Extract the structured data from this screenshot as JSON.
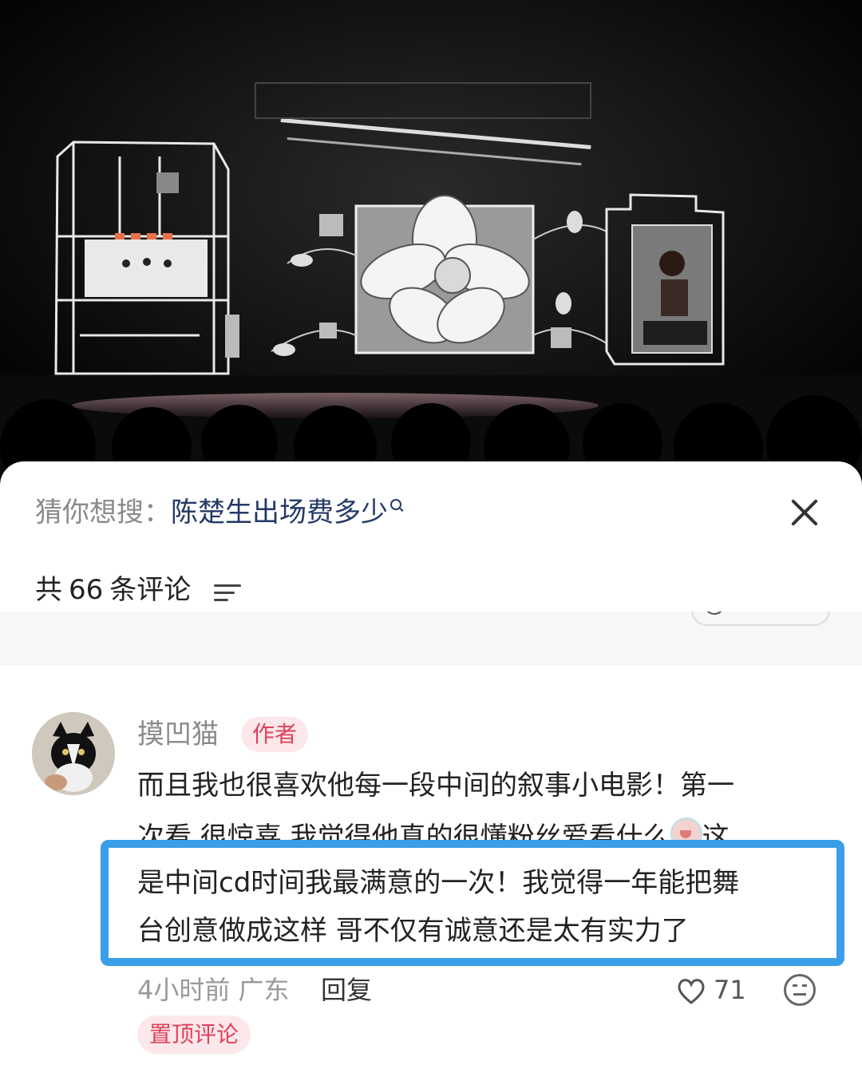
{
  "search_suggestion": {
    "prefix": "猜你想搜：",
    "term": "陈楚生出场费多少"
  },
  "comments_header": {
    "label_prefix": "共",
    "count": "66",
    "label_suffix": "条评论"
  },
  "previous_comment_meta": {
    "time": "",
    "dislike": ""
  },
  "comment": {
    "username": "摸凹猫",
    "badge": "作者",
    "lines": [
      "而且我也很喜欢他每一段中间的叙事小电影！第一",
      "次看 很惊喜 我觉得他真的很懂粉丝爱看什么",
      "这",
      "是中间cd时间我最满意的一次！我觉得一年能把舞",
      "台创意做成这样 哥不仅有诚意还是太有实力了"
    ],
    "time": "4小时前",
    "location": "广东",
    "reply_label": "回复",
    "likes": "71",
    "pinned_label": "置顶评论"
  },
  "colors": {
    "highlight": "#3a9ee8",
    "author_badge_bg": "#fce8ea",
    "author_badge_text": "#e0405a",
    "suggest_term": "#243a66"
  }
}
